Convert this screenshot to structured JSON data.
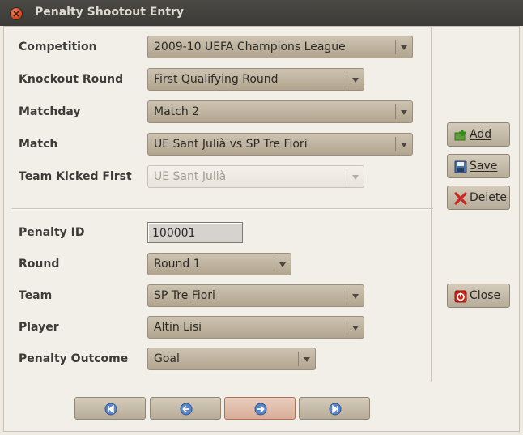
{
  "window": {
    "title": "Penalty Shootout Entry"
  },
  "form": {
    "competition": {
      "label": "Competition",
      "value": "2009-10 UEFA Champions League"
    },
    "knockout_round": {
      "label": "Knockout Round",
      "value": "First Qualifying Round"
    },
    "matchday": {
      "label": "Matchday",
      "value": "Match 2"
    },
    "match": {
      "label": "Match",
      "value": "UE Sant Julià vs SP Tre Fiori"
    },
    "team_kicked_first": {
      "label": "Team Kicked First",
      "value": "UE Sant Julià"
    },
    "penalty_id": {
      "label": "Penalty ID",
      "value": "100001"
    },
    "round": {
      "label": "Round",
      "value": "Round 1"
    },
    "team": {
      "label": "Team",
      "value": "SP Tre Fiori"
    },
    "player": {
      "label": "Player",
      "value": "Altin Lisi"
    },
    "penalty_outcome": {
      "label": "Penalty Outcome",
      "value": "Goal"
    }
  },
  "buttons": {
    "add": "Add",
    "save": "Save",
    "delete": "Delete",
    "close": "Close"
  },
  "nav": {
    "icons": [
      "first-record-icon",
      "previous-record-icon",
      "next-record-icon",
      "last-record-icon"
    ]
  }
}
